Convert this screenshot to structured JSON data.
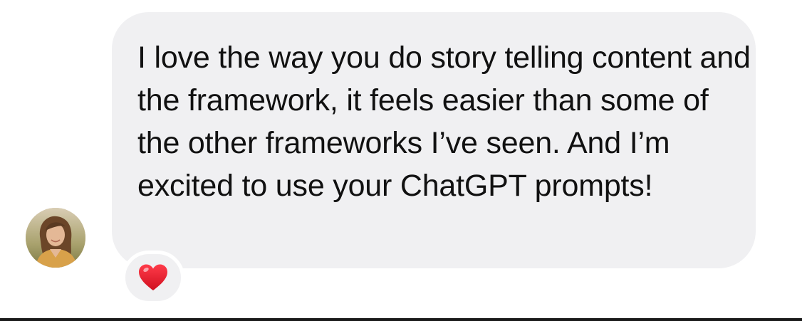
{
  "message": {
    "text": "I love the way you do story telling content and the framework, it feels easier than some of the other frameworks I’ve seen. And I’m excited to use your ChatGPT prompts!",
    "bubble_color": "#f0f0f2",
    "text_color": "#111111"
  },
  "sender": {
    "avatar_icon": "person-photo-icon"
  },
  "reaction": {
    "icon": "red-heart-icon",
    "color": "#e8192c"
  }
}
